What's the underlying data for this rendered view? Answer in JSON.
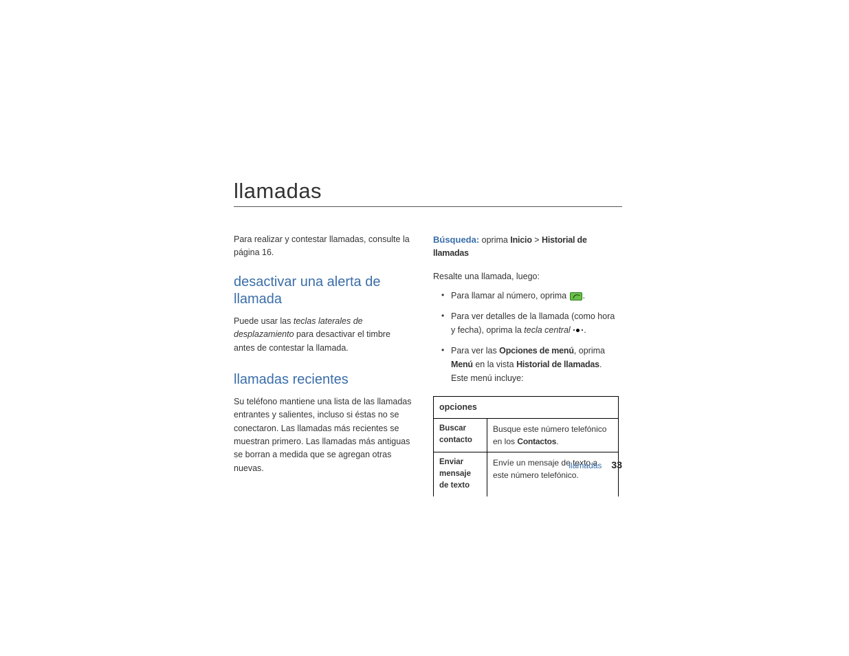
{
  "title": "llamadas",
  "left": {
    "intro": "Para realizar y contestar llamadas, consulte la página 16.",
    "h_alerta": "desactivar una alerta de llamada",
    "p_alerta_1": "Puede usar las ",
    "p_alerta_italic": "teclas laterales de desplazamiento",
    "p_alerta_2": " para desactivar el timbre antes de contestar la llamada.",
    "h_recientes": "llamadas recientes",
    "p_recientes": "Su teléfono mantiene una lista de las llamadas entrantes y salientes, incluso si éstas no se conectaron. Las llamadas más recientes se muestran primero. Las llamadas más antiguas se borran a medida que se agregan otras nuevas."
  },
  "right": {
    "busqueda_label": "Búsqueda:",
    "busqueda_text": " oprima ",
    "busqueda_inicio": "Inicio",
    "busqueda_gt": " > ",
    "busqueda_hist": "Historial de llamadas",
    "resalte": "Resalte una llamada, luego:",
    "bullets": {
      "b1_pre": "Para llamar al número, oprima ",
      "b1_post": ".",
      "b2_pre": "Para ver detalles de la llamada (como hora y fecha), oprima la ",
      "b2_italic": "tecla central",
      "b2_post": " ",
      "b2_end": ".",
      "b3_pre": "Para ver las ",
      "b3_bold1": "Opciones de menú",
      "b3_mid": ", oprima ",
      "b3_bold2": "Menú",
      "b3_mid2": " en la vista ",
      "b3_bold3": "Historial de llamadas",
      "b3_end": ". Este menú incluye:"
    },
    "table": {
      "header": "opciones",
      "rows": [
        {
          "left": "Buscar contacto",
          "r_pre": "Busque este número telefónico en los ",
          "r_bold": "Contactos",
          "r_post": "."
        },
        {
          "left": "Enviar mensaje de texto",
          "r_pre": "Envíe un mensaje de texto a este número telefónico.",
          "r_bold": "",
          "r_post": ""
        }
      ]
    }
  },
  "footer": {
    "label": "llamadas",
    "page": "33"
  }
}
